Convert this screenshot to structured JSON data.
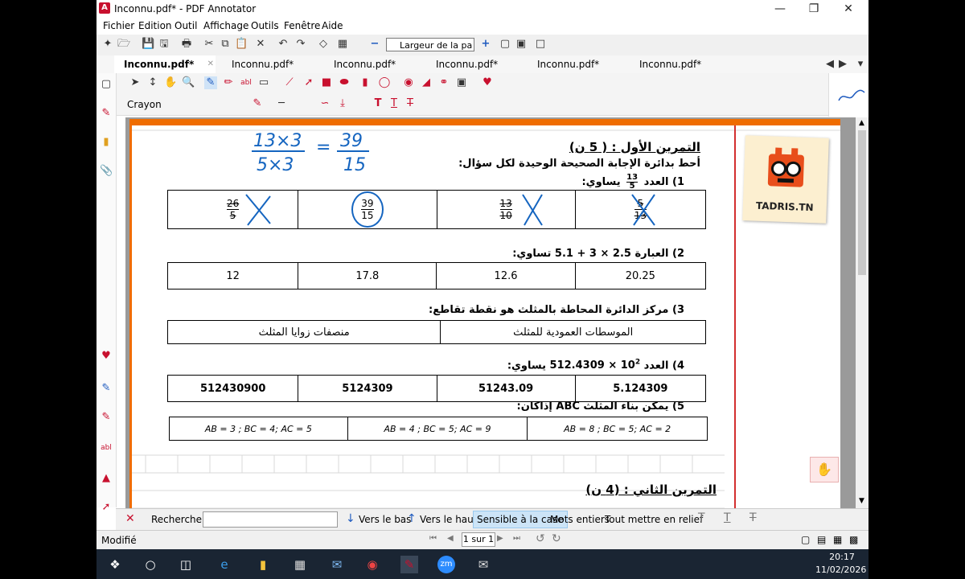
{
  "window": {
    "title": "Inconnu.pdf* - PDF Annotator"
  },
  "menu": [
    "Fichier",
    "Edition",
    "Outil",
    "Affichage",
    "Outils",
    "Fenêtre",
    "Aide"
  ],
  "toolbar": {
    "zoom_value": "Largeur de la pa"
  },
  "tabs": [
    "Inconnu.pdf*",
    "Inconnu.pdf*",
    "Inconnu.pdf*",
    "Inconnu.pdf*",
    "Inconnu.pdf*",
    "Inconnu.pdf*"
  ],
  "annotation_bar": {
    "tool_name": "Crayon"
  },
  "doc": {
    "logo_text": "TADRIS.TN",
    "handwriting": {
      "top_left": "13×3",
      "bottom_left": "5×3",
      "equals": "=",
      "top_right": "39",
      "bottom_right": "15"
    },
    "ex1_title": "التمرين الأول : ( 5 ن)",
    "ex1_instruction": "أحط بدائرة الإجابة الصحيحة الوحيدة لكل سؤال:",
    "q1": {
      "label": "1)  العدد",
      "frac_num": "13",
      "frac_den": "5",
      "tail": "يساوي:",
      "answers": [
        {
          "num": "5",
          "den": "13"
        },
        {
          "num": "13",
          "den": "10"
        },
        {
          "num": "39",
          "den": "15"
        },
        {
          "num": "26",
          "den": "5"
        }
      ]
    },
    "q2": {
      "text": "2)  العبارة  2.5 × 3 + 5.1  تساوي:",
      "answers": [
        "20.25",
        "12.6",
        "17.8",
        "12"
      ]
    },
    "q3": {
      "text": "3)  مركز الدائرة المحاطة بالمثلث هو نقطة تقاطع:",
      "answers": [
        "الموسطات العمودية للمثلث",
        "منصفات زوايا المثلث"
      ]
    },
    "q4": {
      "prefix": "4)  العدد ",
      "base": "512.4309 × 10",
      "exp": "2",
      "suffix": "  يساوي:",
      "answers": [
        "5.124309",
        "51243.09",
        "5124309",
        "512430900"
      ]
    },
    "q5": {
      "text": "5)  يمكن بناء المثلث ABC إذاكان:",
      "answers": [
        "AB = 8 ; BC = 5; AC = 2",
        "AB = 4 ; BC = 5; AC = 9",
        "AB = 3 ; BC = 4; AC = 5"
      ]
    },
    "ex2_title": "التمرين الثاني : (4 ن)"
  },
  "search": {
    "label": "Rechercher:",
    "down": "Vers le bas",
    "up": "Vers le haut",
    "case": "Sensible à la case",
    "whole": "Mots entiers",
    "highlight": "Tout mettre en relief"
  },
  "status": {
    "left": "Modifié",
    "page_indicator": "1 sur 1"
  },
  "taskbar": {
    "time": "20:17",
    "date": "11/02/2026"
  },
  "colors": {
    "accent": "#c8102e",
    "ink_blue": "#1565c0",
    "margin_red": "#d32f2f"
  }
}
